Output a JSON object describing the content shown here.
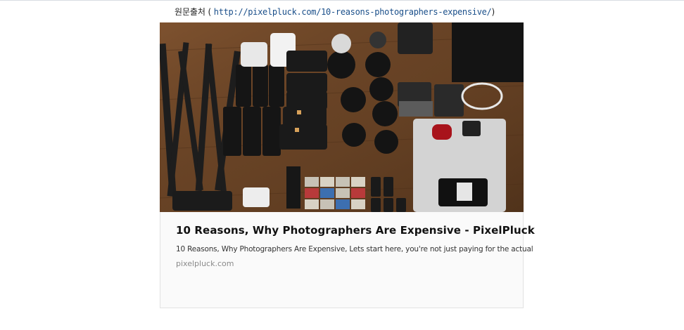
{
  "source": {
    "label": "원문출처 ( ",
    "url": "http://pixelpluck.com/10-reasons-photographers-expensive/",
    "close": ")"
  },
  "card": {
    "image_alt": "Photography gear laid out on a wooden floor",
    "title": "10 Reasons, Why Photographers Are Expensive - PixelPluck",
    "description": "10 Reasons, Why Photographers Are Expensive, Lets start here, you're not just paying for the actual",
    "domain": "pixelpluck.com"
  },
  "colors": {
    "link": "#1a4f8a",
    "card_bg": "#fafafa",
    "card_border": "#e2e2e2"
  }
}
